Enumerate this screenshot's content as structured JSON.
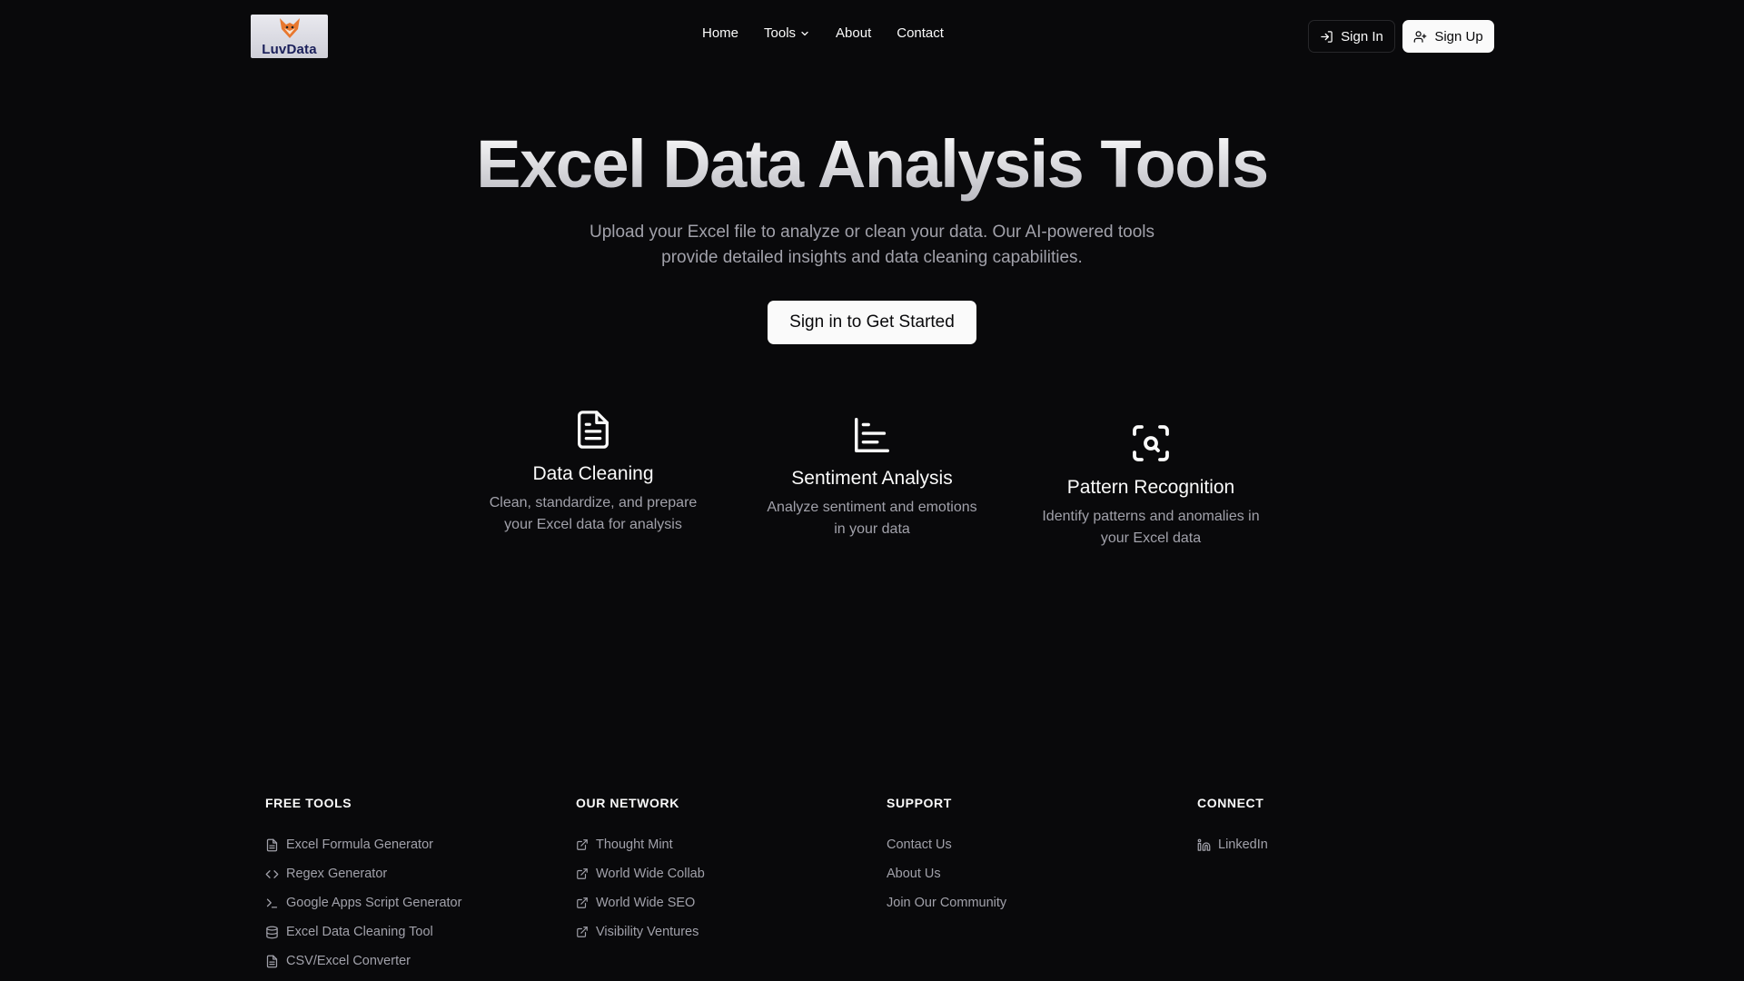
{
  "brand": {
    "logo_text": "LuvData"
  },
  "nav": {
    "home": "Home",
    "tools": "Tools",
    "about": "About",
    "contact": "Contact"
  },
  "auth": {
    "sign_in": "Sign In",
    "sign_up": "Sign Up"
  },
  "hero": {
    "title": "Excel Data Analysis Tools",
    "subtitle_line1": "Upload your Excel file to analyze or clean your data. Our AI-powered tools",
    "subtitle_line2": "provide detailed insights and data cleaning capabilities.",
    "cta": "Sign in to Get Started"
  },
  "features": [
    {
      "icon": "file-text-icon",
      "title": "Data Cleaning",
      "desc": "Clean, standardize, and prepare your Excel data for analysis"
    },
    {
      "icon": "bar-chart-icon",
      "title": "Sentiment Analysis",
      "desc": "Analyze sentiment and emotions in your data"
    },
    {
      "icon": "scan-search-icon",
      "title": "Pattern Recognition",
      "desc": "Identify patterns and anomalies in your Excel data"
    }
  ],
  "footer": {
    "free_tools": {
      "heading": "FREE TOOLS",
      "items": [
        {
          "label": "Excel Formula Generator",
          "icon": "file-text-icon"
        },
        {
          "label": "Regex Generator",
          "icon": "code-icon"
        },
        {
          "label": "Google Apps Script Generator",
          "icon": "terminal-icon"
        },
        {
          "label": "Excel Data Cleaning Tool",
          "icon": "database-icon"
        },
        {
          "label": "CSV/Excel Converter",
          "icon": "file-text-icon"
        }
      ]
    },
    "network": {
      "heading": "OUR NETWORK",
      "items": [
        {
          "label": "Thought Mint",
          "icon": "external-link-icon"
        },
        {
          "label": "World Wide Collab",
          "icon": "external-link-icon"
        },
        {
          "label": "World Wide SEO",
          "icon": "external-link-icon"
        },
        {
          "label": "Visibility Ventures",
          "icon": "external-link-icon"
        }
      ]
    },
    "support": {
      "heading": "SUPPORT",
      "items": [
        {
          "label": "Contact Us"
        },
        {
          "label": "About Us"
        },
        {
          "label": "Join Our Community"
        }
      ]
    },
    "connect": {
      "heading": "CONNECT",
      "items": [
        {
          "label": "LinkedIn",
          "icon": "linkedin-icon"
        }
      ]
    }
  }
}
